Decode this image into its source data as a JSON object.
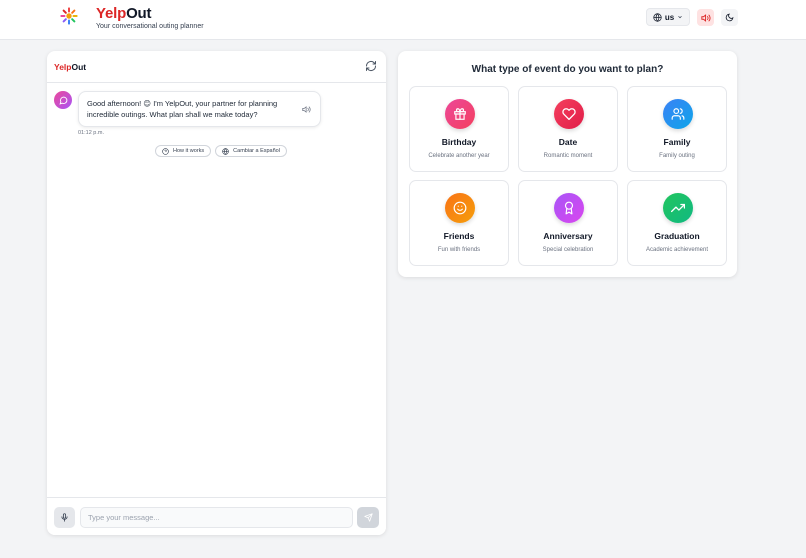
{
  "header": {
    "brand_yelp": "Yelp",
    "brand_out": "Out",
    "tagline": "Your conversational outing planner",
    "language_label": "us"
  },
  "chat": {
    "title_yelp": "Yelp",
    "title_out": "Out",
    "bot_message": "Good afternoon! 😊 I'm YelpOut, your partner for planning incredible outings. What plan shall we make today?",
    "message_time": "01:12 p.m.",
    "quick_actions": [
      {
        "label": "How it works",
        "icon": "help-circle-icon"
      },
      {
        "label": "Cambiar a Español",
        "icon": "globe-icon"
      }
    ],
    "input_placeholder": "Type your message..."
  },
  "events": {
    "title": "What type of event do you want to plan?",
    "cards": [
      {
        "title": "Birthday",
        "subtitle": "Celebrate another year",
        "icon": "gift-icon",
        "color_from": "#ec4899",
        "color_to": "#f43f5e"
      },
      {
        "title": "Date",
        "subtitle": "Romantic moment",
        "icon": "heart-icon",
        "color_from": "#f43f5e",
        "color_to": "#e11d48"
      },
      {
        "title": "Family",
        "subtitle": "Family outing",
        "icon": "users-icon",
        "color_from": "#3b82f6",
        "color_to": "#0ea5e9"
      },
      {
        "title": "Friends",
        "subtitle": "Fun with friends",
        "icon": "smile-icon",
        "color_from": "#f97316",
        "color_to": "#f59e0b"
      },
      {
        "title": "Anniversary",
        "subtitle": "Special celebration",
        "icon": "award-icon",
        "color_from": "#a855f7",
        "color_to": "#d946ef"
      },
      {
        "title": "Graduation",
        "subtitle": "Academic achievement",
        "icon": "trending-up-icon",
        "color_from": "#22c55e",
        "color_to": "#10b981"
      }
    ]
  }
}
